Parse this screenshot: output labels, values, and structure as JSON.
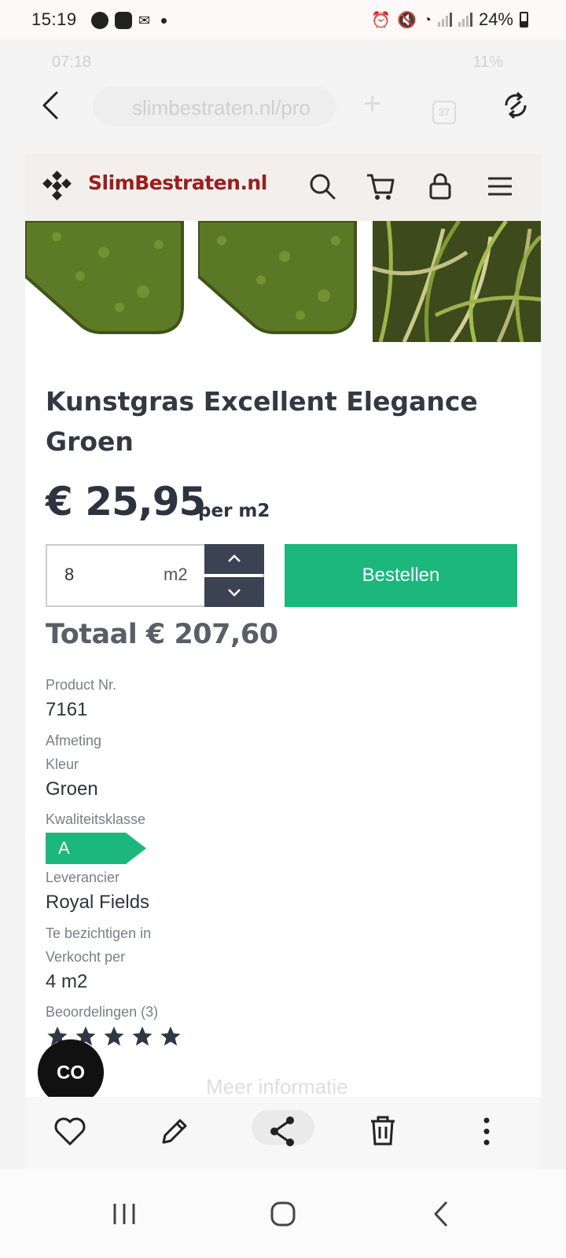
{
  "status_bar": {
    "time": "15:19",
    "battery": "24%"
  },
  "ghost_screen": {
    "time": "07:18",
    "battery": "11%",
    "url": "slimbestraten.nl/pro",
    "tab_count": "37"
  },
  "site": {
    "brand": "SlimBestraten.nl",
    "brand_color": "#9c1d1d",
    "header_icons": [
      "search-icon",
      "cart-icon",
      "lock-icon",
      "menu-icon"
    ]
  },
  "product": {
    "title_line1": "Kunstgras Excellent Elegance",
    "title_line2": "Groen",
    "price": "€ 25,95",
    "price_unit": "per m2",
    "quantity": "8",
    "quantity_unit": "m2",
    "order_label": "Bestellen",
    "total": "Totaal € 207,60",
    "accent_color": "#1cb77c"
  },
  "specs": {
    "product_nr_label": "Product Nr.",
    "product_nr_value": "7161",
    "afmeting_label": "Afmeting",
    "kleur_label": "Kleur",
    "kleur_value": "Groen",
    "kwaliteit_label": "Kwaliteitsklasse",
    "kwaliteit_value": "A",
    "leverancier_label": "Leverancier",
    "leverancier_value": "Royal Fields",
    "bezichtigen_label": "Te bezichtigen in",
    "verkocht_label": "Verkocht per",
    "verkocht_value": "4 m2",
    "reviews_label": "Beoordelingen (3)",
    "rating": 5
  },
  "more_info": "Meer informatie",
  "chat_label": "CO",
  "toolbar_icons": [
    "heart-icon",
    "pencil-icon",
    "share-icon",
    "trash-icon",
    "more-icon"
  ],
  "nav_icons": [
    "recents-icon",
    "home-icon",
    "back-icon"
  ]
}
